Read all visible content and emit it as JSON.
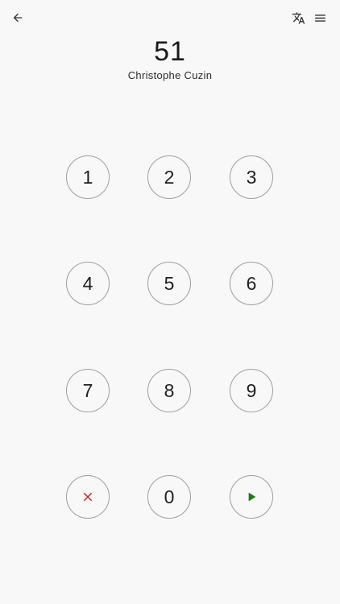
{
  "header": {
    "back_icon": "arrow-left-icon",
    "translate_icon": "translate-icon",
    "menu_icon": "hamburger-menu-icon"
  },
  "display": {
    "number": "51",
    "name": "Christophe Cuzin"
  },
  "keypad": {
    "k1": "1",
    "k2": "2",
    "k3": "3",
    "k4": "4",
    "k5": "5",
    "k6": "6",
    "k7": "7",
    "k8": "8",
    "k9": "9",
    "k0": "0",
    "clear_icon": "close-icon",
    "submit_icon": "play-icon"
  },
  "colors": {
    "background": "#f8f8f8",
    "key_border": "#9e9e9e",
    "clear": "#c62828",
    "submit": "#1b7a1b"
  }
}
